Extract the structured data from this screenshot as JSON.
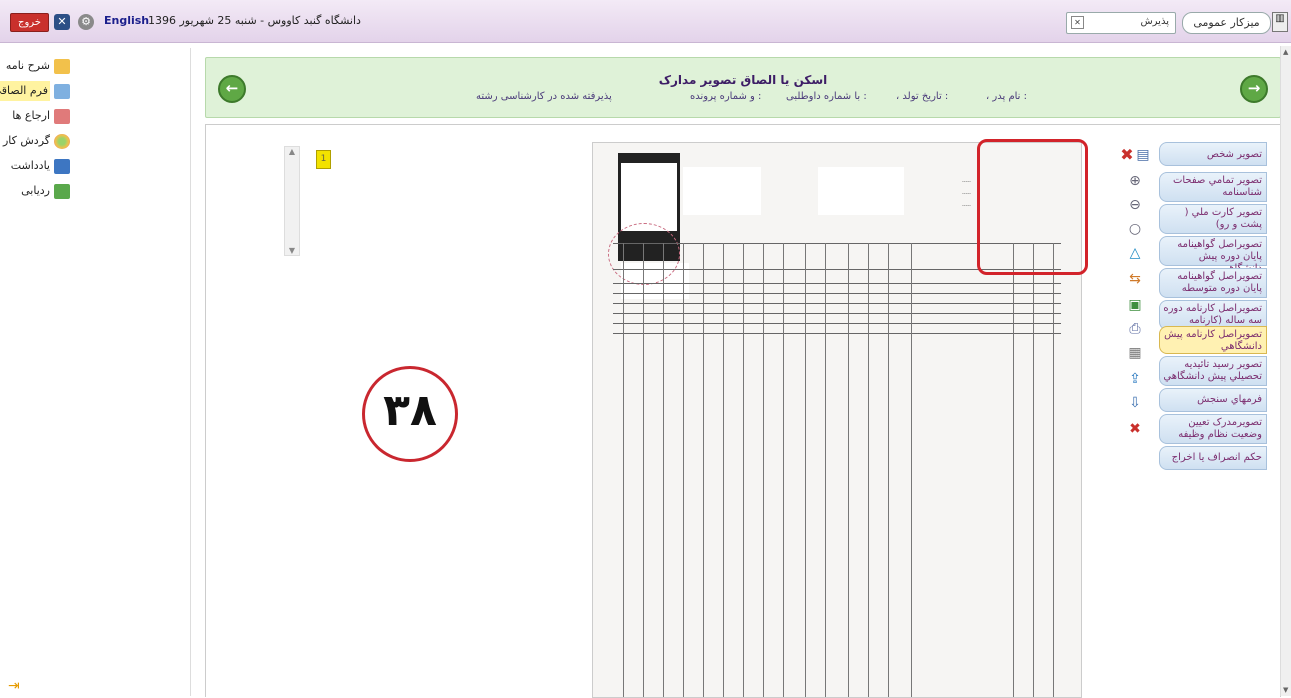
{
  "topbar": {
    "exit_label": "خروج",
    "language_label": "English",
    "date_line": "دانشگاه گنبد کاووس - شنبه 25 شهریور 1396",
    "search_value": "پذیرش",
    "desk_label": "میزکار عمومی"
  },
  "sidebar": {
    "items": [
      {
        "label": "شرح نامه",
        "icon": "letter-icon",
        "active": false
      },
      {
        "label": "فرم الصاقی",
        "icon": "form-icon",
        "active": true
      },
      {
        "label": "ارجاع ها",
        "icon": "refer-icon",
        "active": false
      },
      {
        "label": "گردش کار",
        "icon": "workflow-icon",
        "active": false
      },
      {
        "label": "یادداشت",
        "icon": "note-icon",
        "active": false
      },
      {
        "label": "ردیابی",
        "icon": "tracking-icon",
        "active": false
      }
    ]
  },
  "header": {
    "title": "اسکن یا الصاق تصویر مدارک",
    "father_name": "، نام پدر :",
    "birth_date": "، تاریخ تولد :",
    "applicant_number": "با شماره داوطلبی :",
    "file_number": "و شماره پرونده :",
    "accepted_field": "پذیرفته شده در کارشناسی رشته"
  },
  "viewer": {
    "thumb_number": "1",
    "page_badge": "۳۸"
  },
  "document_tabs": [
    {
      "label": "تصویر شخص",
      "active": false
    },
    {
      "label": "تصویر تمامي صفحات شناسنامه",
      "active": false
    },
    {
      "label": "تصویر کارت ملي ( پشت و رو)",
      "active": false
    },
    {
      "label": "تصویراصل گواهینامه پایان دوره پیش دانشگاهي",
      "active": false
    },
    {
      "label": "تصویراصل گواهینامه پایان دوره متوسطه",
      "active": false
    },
    {
      "label": "تصویراصل کارنامه دوره سه ساله (کارنامه کامپیوتري)",
      "active": false
    },
    {
      "label": "تصویراصل کارنامه پیش دانشگاهي",
      "active": true
    },
    {
      "label": "تصویر رسید تائیدیه تحصیلي پیش دانشگاهي",
      "active": false
    },
    {
      "label": "فرمهاي سنجش",
      "active": false
    },
    {
      "label": "تصویرمدرک تعیین وضعیت نظام وظیفه",
      "active": false
    },
    {
      "label": "حکم انصراف یا اخراج",
      "active": false
    }
  ],
  "colors": {
    "topbar": "#e3d3ea",
    "header_panel": "#dff2d8",
    "accent_red": "#d2232a",
    "tab_text": "#7b2c6e"
  }
}
